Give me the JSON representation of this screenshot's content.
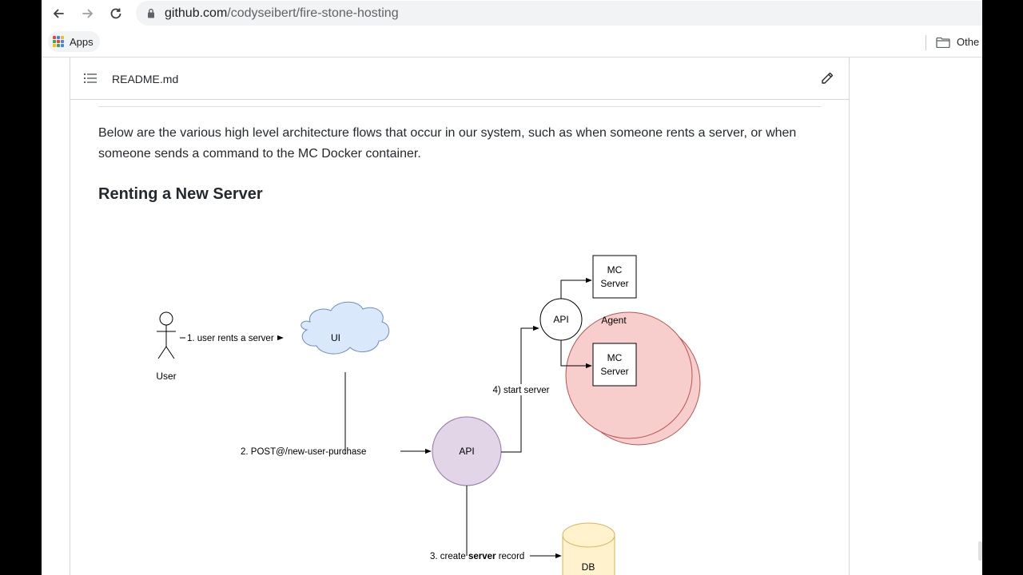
{
  "browser": {
    "url_host": "github.com",
    "url_path": "/codyseibert/fire-stone-hosting",
    "back_icon": "arrow-left-icon",
    "forward_icon": "arrow-right-icon",
    "reload_icon": "reload-icon",
    "lock_icon": "lock-icon"
  },
  "bookmarks": {
    "apps_label": "Apps",
    "other_label": "Othe"
  },
  "readme": {
    "filename": "README.md",
    "intro": "Below are the various high level architecture flows that occur in our system, such as when someone rents a server, or when someone sends a command to the MC Docker container.",
    "heading": "Renting a New Server"
  },
  "diagram": {
    "user_label": "User",
    "step1": "1. user rents a server",
    "ui_label": "UI",
    "step2": "2. POST@/new-user-purchase",
    "api_label": "API",
    "step3_prefix": "3. create ",
    "step3_bold": "server",
    "step3_suffix": " record",
    "db_label": "DB",
    "step4": "4) start server",
    "agent_api_label": "API",
    "agent_label": "Agent",
    "mc_line1": "MC",
    "mc_line2": "Server"
  },
  "colors": {
    "cloud_fill": "#dae8fc",
    "cloud_stroke": "#6c8ebf",
    "api_fill": "#e1d5e7",
    "api_stroke": "#9673a6",
    "agent_fill": "#f8cecc",
    "agent_stroke": "#b85450",
    "db_fill": "#fff2cc",
    "db_stroke": "#d6b656"
  }
}
